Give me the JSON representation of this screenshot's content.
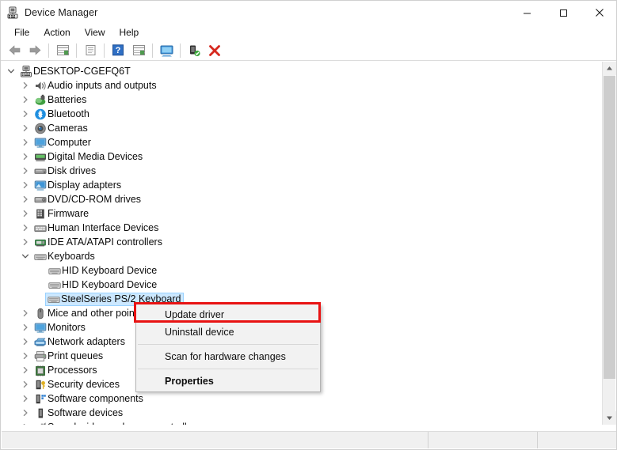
{
  "window": {
    "title": "Device Manager",
    "icon": "device-manager-icon",
    "controls": {
      "minimize": "minimize-icon",
      "maximize": "maximize-icon",
      "close": "close-icon"
    }
  },
  "menubar": {
    "items": [
      {
        "label": "File"
      },
      {
        "label": "Action"
      },
      {
        "label": "View"
      },
      {
        "label": "Help"
      }
    ]
  },
  "toolbar": {
    "buttons": [
      {
        "name": "back-arrow-icon",
        "title": "Back"
      },
      {
        "name": "forward-arrow-icon",
        "title": "Forward"
      },
      {
        "name": "show-hide-console-tree-icon",
        "title": "Show/Hide console tree"
      },
      {
        "name": "properties-icon",
        "title": "Properties"
      },
      {
        "name": "help-icon",
        "title": "Help"
      },
      {
        "name": "scan-for-hardware-changes-icon",
        "title": "Scan for hardware changes"
      },
      {
        "name": "update-driver-icon",
        "title": "Update driver"
      },
      {
        "name": "enable-device-icon",
        "title": "Enable device"
      },
      {
        "name": "uninstall-device-icon",
        "title": "Uninstall device"
      }
    ]
  },
  "tree": {
    "nodes": [
      {
        "label": "DESKTOP-CGEFQ6T",
        "level": 0,
        "state": "expanded",
        "icon": "computer-root-icon"
      },
      {
        "label": "Audio inputs and outputs",
        "level": 1,
        "state": "collapsed",
        "icon": "speaker-icon"
      },
      {
        "label": "Batteries",
        "level": 1,
        "state": "collapsed",
        "icon": "battery-icon"
      },
      {
        "label": "Bluetooth",
        "level": 1,
        "state": "collapsed",
        "icon": "bluetooth-icon"
      },
      {
        "label": "Cameras",
        "level": 1,
        "state": "collapsed",
        "icon": "camera-icon"
      },
      {
        "label": "Computer",
        "level": 1,
        "state": "collapsed",
        "icon": "monitor-icon"
      },
      {
        "label": "Digital Media Devices",
        "level": 1,
        "state": "collapsed",
        "icon": "media-device-icon"
      },
      {
        "label": "Disk drives",
        "level": 1,
        "state": "collapsed",
        "icon": "disk-drive-icon"
      },
      {
        "label": "Display adapters",
        "level": 1,
        "state": "collapsed",
        "icon": "display-adapter-icon"
      },
      {
        "label": "DVD/CD-ROM drives",
        "level": 1,
        "state": "collapsed",
        "icon": "dvd-drive-icon"
      },
      {
        "label": "Firmware",
        "level": 1,
        "state": "collapsed",
        "icon": "firmware-icon"
      },
      {
        "label": "Human Interface Devices",
        "level": 1,
        "state": "collapsed",
        "icon": "hid-icon"
      },
      {
        "label": "IDE ATA/ATAPI controllers",
        "level": 1,
        "state": "collapsed",
        "icon": "ide-controller-icon"
      },
      {
        "label": "Keyboards",
        "level": 1,
        "state": "expanded",
        "icon": "keyboard-icon"
      },
      {
        "label": "HID Keyboard Device",
        "level": 2,
        "state": "leaf",
        "icon": "keyboard-icon"
      },
      {
        "label": "HID Keyboard Device",
        "level": 2,
        "state": "leaf",
        "icon": "keyboard-icon"
      },
      {
        "label": "SteelSeries PS/2 Keyboard",
        "level": 2,
        "state": "leaf",
        "icon": "keyboard-icon",
        "selected": true
      },
      {
        "label": "Mice and other pointing devices",
        "level": 1,
        "state": "collapsed",
        "icon": "mouse-icon"
      },
      {
        "label": "Monitors",
        "level": 1,
        "state": "collapsed",
        "icon": "monitor-icon"
      },
      {
        "label": "Network adapters",
        "level": 1,
        "state": "collapsed",
        "icon": "network-adapter-icon"
      },
      {
        "label": "Print queues",
        "level": 1,
        "state": "collapsed",
        "icon": "printer-icon"
      },
      {
        "label": "Processors",
        "level": 1,
        "state": "collapsed",
        "icon": "processor-icon"
      },
      {
        "label": "Security devices",
        "level": 1,
        "state": "collapsed",
        "icon": "security-device-icon"
      },
      {
        "label": "Software components",
        "level": 1,
        "state": "collapsed",
        "icon": "software-component-icon"
      },
      {
        "label": "Software devices",
        "level": 1,
        "state": "collapsed",
        "icon": "software-device-icon"
      },
      {
        "label": "Sound, video and game controllers",
        "level": 1,
        "state": "collapsed",
        "icon": "sound-controller-icon"
      }
    ]
  },
  "context_menu": {
    "items": [
      {
        "label": "Update driver",
        "bold": false,
        "separator_after": false,
        "highlighted": true
      },
      {
        "label": "Uninstall device",
        "bold": false,
        "separator_after": true,
        "highlighted": false
      },
      {
        "label": "Scan for hardware changes",
        "bold": false,
        "separator_after": true,
        "highlighted": false
      },
      {
        "label": "Properties",
        "bold": true,
        "separator_after": false,
        "highlighted": false
      }
    ]
  },
  "annotation": {
    "target": "Update driver",
    "color": "#e81313"
  },
  "statusbar": {
    "panel1": "",
    "panel2": "",
    "panel3": ""
  },
  "colors": {
    "selection": "#cce8ff",
    "annotation": "#e81313",
    "menu_bg": "#f2f2f2",
    "scrollbar_thumb": "#cdcdcd"
  }
}
